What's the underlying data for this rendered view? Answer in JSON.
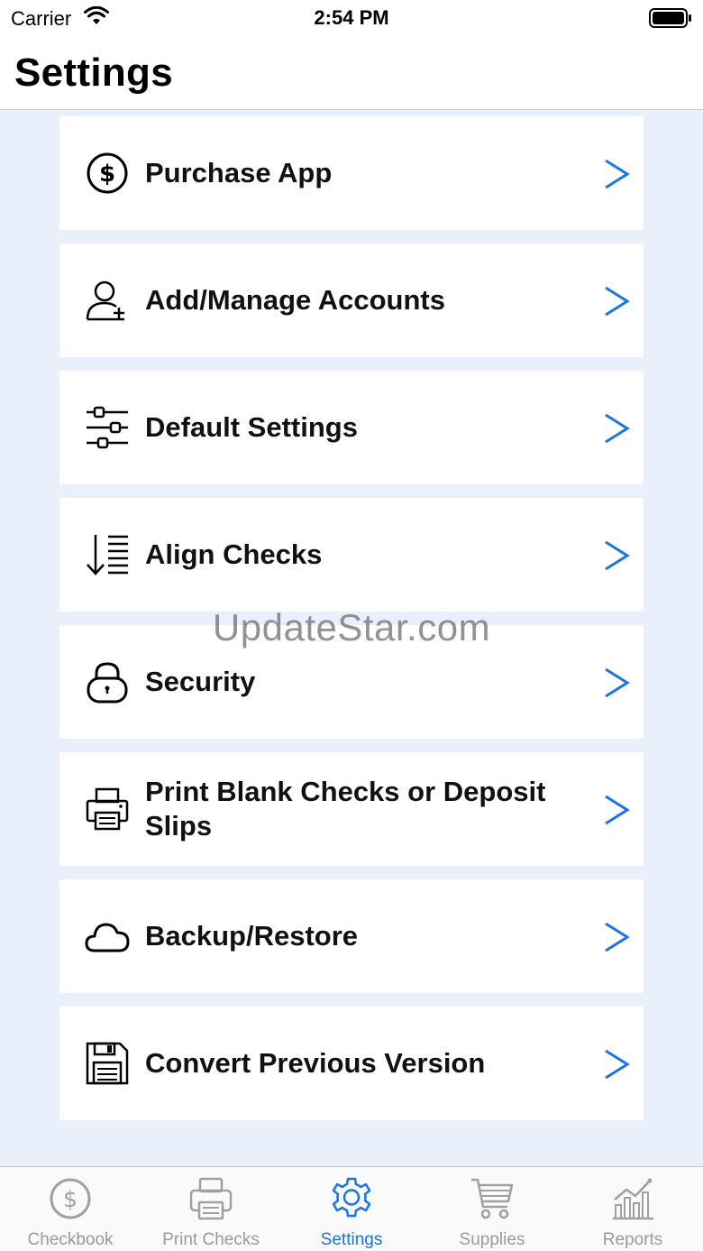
{
  "status_bar": {
    "carrier": "Carrier",
    "time": "2:54 PM"
  },
  "header": {
    "title": "Settings"
  },
  "settings_items": [
    {
      "label": "Purchase App",
      "icon": "dollar-circle-icon"
    },
    {
      "label": "Add/Manage Accounts",
      "icon": "add-user-icon"
    },
    {
      "label": "Default Settings",
      "icon": "sliders-icon"
    },
    {
      "label": "Align Checks",
      "icon": "sort-descending-icon"
    },
    {
      "label": "Security",
      "icon": "lock-icon"
    },
    {
      "label": "Print Blank Checks or Deposit Slips",
      "icon": "printer-icon"
    },
    {
      "label": "Backup/Restore",
      "icon": "cloud-icon"
    },
    {
      "label": "Convert Previous Version",
      "icon": "floppy-disk-icon"
    }
  ],
  "watermark": "UpdateStar.com",
  "tab_bar": {
    "tabs": [
      {
        "label": "Checkbook",
        "icon": "dollar-circle-icon",
        "active": false
      },
      {
        "label": "Print Checks",
        "icon": "printer-icon",
        "active": false
      },
      {
        "label": "Settings",
        "icon": "gear-icon",
        "active": true
      },
      {
        "label": "Supplies",
        "icon": "shopping-cart-icon",
        "active": false
      },
      {
        "label": "Reports",
        "icon": "chart-icon",
        "active": false
      }
    ]
  },
  "colors": {
    "accent": "#1a73e8",
    "background": "#eaf0fb",
    "tab_inactive": "#9a9a9a"
  }
}
